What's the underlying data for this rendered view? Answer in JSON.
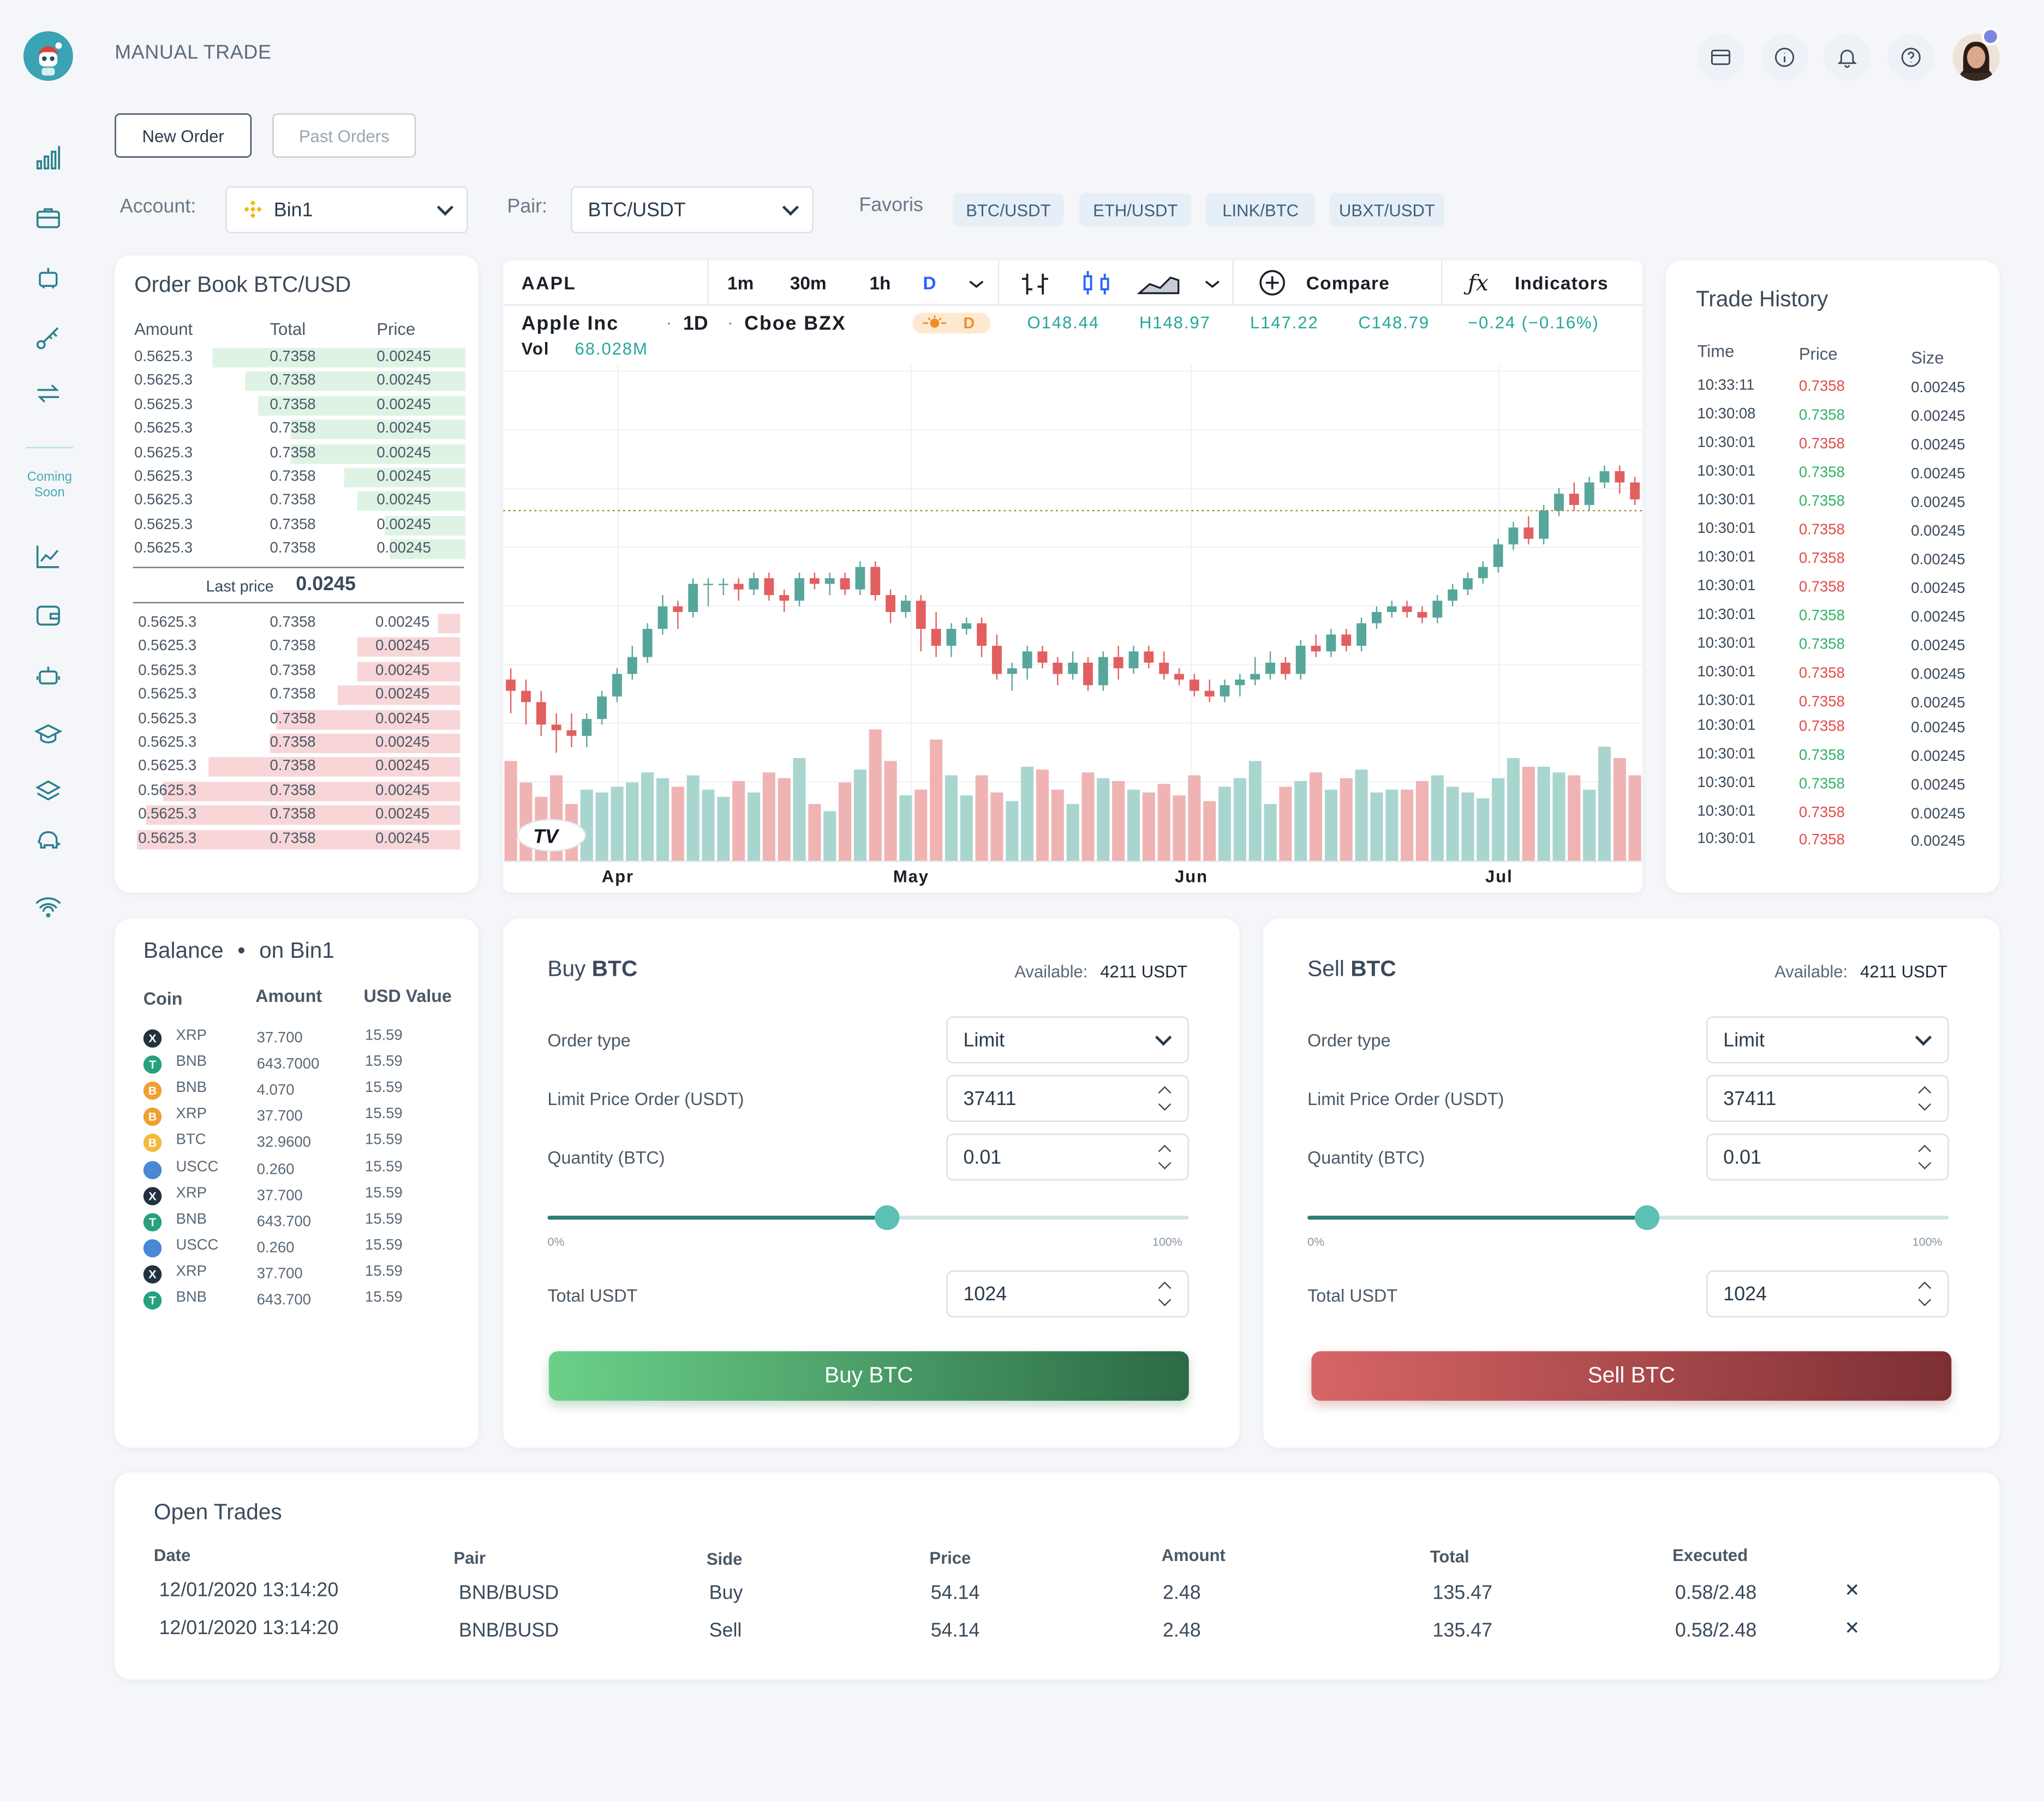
{
  "app": {
    "title": "MANUAL TRADE"
  },
  "sidebar": {
    "coming_soon": "Coming Soon"
  },
  "tabs": {
    "new_order": "New Order",
    "past_orders": "Past Orders"
  },
  "filters": {
    "account_label": "Account:",
    "account_value": "Bin1",
    "pair_label": "Pair:",
    "pair_value": "BTC/USDT",
    "favoris_label": "Favoris",
    "favorites": [
      "BTC/USDT",
      "ETH/USDT",
      "LINK/BTC",
      "UBXT/USDT"
    ]
  },
  "order_book": {
    "title": "Order Book BTC/USD",
    "headers": [
      "Amount",
      "Total",
      "Price"
    ],
    "asks": [
      {
        "amount": "0.5625.3",
        "total": "0.7358",
        "price": "0.00245",
        "depth": 1.0
      },
      {
        "amount": "0.5625.3",
        "total": "0.7358",
        "price": "0.00245",
        "depth": 0.87
      },
      {
        "amount": "0.5625.3",
        "total": "0.7358",
        "price": "0.00245",
        "depth": 0.82
      },
      {
        "amount": "0.5625.3",
        "total": "0.7358",
        "price": "0.00245",
        "depth": 0.69
      },
      {
        "amount": "0.5625.3",
        "total": "0.7358",
        "price": "0.00245",
        "depth": 0.69
      },
      {
        "amount": "0.5625.3",
        "total": "0.7358",
        "price": "0.00245",
        "depth": 0.48
      },
      {
        "amount": "0.5625.3",
        "total": "0.7358",
        "price": "0.00245",
        "depth": 0.43
      },
      {
        "amount": "0.5625.3",
        "total": "0.7358",
        "price": "0.00245",
        "depth": 0.32
      },
      {
        "amount": "0.5625.3",
        "total": "0.7358",
        "price": "0.00245",
        "depth": 0.3
      }
    ],
    "last_price_label": "Last price",
    "last_price": "0.0245",
    "bids": [
      {
        "amount": "0.5625.3",
        "total": "0.7358",
        "price": "0.00245",
        "depth": 0.07
      },
      {
        "amount": "0.5625.3",
        "total": "0.7358",
        "price": "0.00245",
        "depth": 0.32
      },
      {
        "amount": "0.5625.3",
        "total": "0.7358",
        "price": "0.00245",
        "depth": 0.32
      },
      {
        "amount": "0.5625.3",
        "total": "0.7358",
        "price": "0.00245",
        "depth": 0.38
      },
      {
        "amount": "0.5625.3",
        "total": "0.7358",
        "price": "0.00245",
        "depth": 0.57
      },
      {
        "amount": "0.5625.3",
        "total": "0.7358",
        "price": "0.00245",
        "depth": 0.59
      },
      {
        "amount": "0.5625.3",
        "total": "0.7358",
        "price": "0.00245",
        "depth": 0.78
      },
      {
        "amount": "0.5625.3",
        "total": "0.7358",
        "price": "0.00245",
        "depth": 0.92
      },
      {
        "amount": "0.5625.3",
        "total": "0.7358",
        "price": "0.00245",
        "depth": 0.97
      },
      {
        "amount": "0.5625.3",
        "total": "0.7358",
        "price": "0.00245",
        "depth": 1.0
      }
    ]
  },
  "chart": {
    "symbol": "AAPL",
    "intervals": [
      "1m",
      "30m",
      "1h",
      "D"
    ],
    "compare": "Compare",
    "indicators": "Indicators",
    "name": "Apple Inc",
    "sep": "·",
    "period": "1D",
    "exchange": "Cboe BZX",
    "badge": "D",
    "ohlc": {
      "o": "O148.44",
      "h": "H148.97",
      "l": "L147.22",
      "c": "C148.79",
      "chg": "−0.24 (−0.16%)"
    },
    "vol_label": "Vol",
    "vol_value": "68.028M",
    "logo": "TV",
    "x_labels": [
      "Apr",
      "May",
      "Jun",
      "Jul"
    ]
  },
  "chart_data": {
    "type": "candlestick",
    "x_labels": [
      "Apr",
      "May",
      "Jun",
      "Jul"
    ],
    "candles": [
      [
        130,
        128,
        124,
        132
      ],
      [
        128,
        126,
        122,
        130
      ],
      [
        126,
        122,
        120,
        128
      ],
      [
        122,
        121,
        117,
        124
      ],
      [
        121,
        120,
        118,
        124
      ],
      [
        120,
        123,
        118,
        124
      ],
      [
        123,
        127,
        122,
        128
      ],
      [
        127,
        131,
        126,
        132
      ],
      [
        131,
        134,
        130,
        136
      ],
      [
        134,
        139,
        133,
        140
      ],
      [
        139,
        143,
        138,
        145
      ],
      [
        143,
        142,
        139,
        144
      ],
      [
        142,
        147,
        141,
        148
      ],
      [
        147,
        147,
        143,
        148
      ],
      [
        147,
        147,
        145,
        148
      ],
      [
        147,
        146,
        144,
        148
      ],
      [
        146,
        148,
        145,
        149
      ],
      [
        148,
        145,
        144,
        149
      ],
      [
        145,
        144,
        142,
        146
      ],
      [
        144,
        148,
        143,
        149
      ],
      [
        148,
        147,
        146,
        149
      ],
      [
        147,
        148,
        145,
        149
      ],
      [
        148,
        146,
        145,
        149
      ],
      [
        146,
        150,
        145,
        151
      ],
      [
        150,
        145,
        144,
        151
      ],
      [
        145,
        142,
        140,
        146
      ],
      [
        142,
        144,
        141,
        145
      ],
      [
        144,
        139,
        135,
        145
      ],
      [
        139,
        136,
        134,
        142
      ],
      [
        136,
        139,
        134,
        140
      ],
      [
        139,
        140,
        138,
        141
      ],
      [
        140,
        136,
        134,
        141
      ],
      [
        136,
        131,
        130,
        138
      ],
      [
        131,
        132,
        128,
        133
      ],
      [
        132,
        135,
        130,
        136
      ],
      [
        135,
        133,
        132,
        136
      ],
      [
        133,
        131,
        129,
        134
      ],
      [
        131,
        133,
        130,
        135
      ],
      [
        133,
        129,
        128,
        134
      ],
      [
        129,
        134,
        128,
        135
      ],
      [
        134,
        132,
        130,
        136
      ],
      [
        132,
        135,
        131,
        136
      ],
      [
        135,
        133,
        132,
        136
      ],
      [
        133,
        131,
        130,
        135
      ],
      [
        131,
        130,
        129,
        132
      ],
      [
        130,
        128,
        127,
        131
      ],
      [
        128,
        127,
        126,
        130
      ],
      [
        127,
        129,
        126,
        130
      ],
      [
        129,
        130,
        127,
        131
      ],
      [
        130,
        131,
        129,
        134
      ],
      [
        131,
        133,
        130,
        135
      ],
      [
        133,
        131,
        130,
        134
      ],
      [
        131,
        136,
        130,
        137
      ],
      [
        136,
        135,
        134,
        138
      ],
      [
        135,
        138,
        134,
        139
      ],
      [
        138,
        136,
        135,
        139
      ],
      [
        136,
        140,
        135,
        141
      ],
      [
        140,
        142,
        139,
        143
      ],
      [
        142,
        143,
        141,
        144
      ],
      [
        143,
        142,
        141,
        144
      ],
      [
        142,
        141,
        140,
        143
      ],
      [
        141,
        144,
        140,
        145
      ],
      [
        144,
        146,
        143,
        147
      ],
      [
        146,
        148,
        145,
        149
      ],
      [
        148,
        150,
        147,
        151
      ],
      [
        150,
        154,
        149,
        155
      ],
      [
        154,
        157,
        153,
        158
      ],
      [
        157,
        155,
        154,
        159
      ],
      [
        155,
        160,
        154,
        161
      ],
      [
        160,
        163,
        159,
        164
      ],
      [
        163,
        161,
        160,
        165
      ],
      [
        161,
        165,
        160,
        166
      ],
      [
        165,
        167,
        164,
        168
      ],
      [
        167,
        165,
        163,
        168
      ],
      [
        165,
        162,
        161,
        166
      ]
    ],
    "volume": [
      70,
      55,
      45,
      60,
      40,
      50,
      48,
      52,
      55,
      62,
      58,
      52,
      60,
      50,
      45,
      56,
      48,
      62,
      58,
      72,
      40,
      35,
      55,
      64,
      92,
      70,
      46,
      50,
      85,
      60,
      46,
      60,
      48,
      42,
      66,
      64,
      50,
      40,
      62,
      58,
      56,
      50,
      48,
      54,
      46,
      60,
      42,
      52,
      58,
      70,
      40,
      52,
      56,
      62,
      50,
      58,
      64,
      48,
      50,
      50,
      56,
      60,
      52,
      48,
      44,
      58,
      72,
      66,
      66,
      62,
      60,
      50,
      80,
      72,
      60
    ],
    "last_price_line": 160
  },
  "trade_history": {
    "title": "Trade History",
    "headers": [
      "Time",
      "Price",
      "Size"
    ],
    "rows": [
      {
        "time": "10:33:11",
        "price": "0.7358",
        "size": "0.00245",
        "side": "sell"
      },
      {
        "time": "10:30:08",
        "price": "0.7358",
        "size": "0.00245",
        "side": "buy"
      },
      {
        "time": "10:30:01",
        "price": "0.7358",
        "size": "0.00245",
        "side": "sell"
      },
      {
        "time": "10:30:01",
        "price": "0.7358",
        "size": "0.00245",
        "side": "buy"
      },
      {
        "time": "10:30:01",
        "price": "0.7358",
        "size": "0.00245",
        "side": "buy"
      },
      {
        "time": "10:30:01",
        "price": "0.7358",
        "size": "0.00245",
        "side": "sell"
      },
      {
        "time": "10:30:01",
        "price": "0.7358",
        "size": "0.00245",
        "side": "sell"
      },
      {
        "time": "10:30:01",
        "price": "0.7358",
        "size": "0.00245",
        "side": "sell"
      },
      {
        "time": "10:30:01",
        "price": "0.7358",
        "size": "0.00245",
        "side": "buy"
      },
      {
        "time": "10:30:01",
        "price": "0.7358",
        "size": "0.00245",
        "side": "buy"
      },
      {
        "time": "10:30:01",
        "price": "0.7358",
        "size": "0.00245",
        "side": "sell"
      },
      {
        "time": "10:30:01",
        "price": "0.7358",
        "size": "0.00245",
        "side": "sell"
      },
      {
        "time": "10:30:01",
        "price": "0.7358",
        "size": "0.00245",
        "side": "sell"
      },
      {
        "time": "10:30:01",
        "price": "0.7358",
        "size": "0.00245",
        "side": "buy"
      },
      {
        "time": "10:30:01",
        "price": "0.7358",
        "size": "0.00245",
        "side": "buy"
      },
      {
        "time": "10:30:01",
        "price": "0.7358",
        "size": "0.00245",
        "side": "sell"
      },
      {
        "time": "10:30:01",
        "price": "0.7358",
        "size": "0.00245",
        "side": "sell"
      }
    ]
  },
  "balance": {
    "title": "Balance",
    "dot": "•",
    "on": "on Bin1",
    "headers": [
      "Coin",
      "Amount",
      "USD Value"
    ],
    "rows": [
      {
        "icon": "X",
        "coin": "XRP",
        "amount": "37.700",
        "usd": "15.59",
        "color": "#23313f"
      },
      {
        "icon": "T",
        "coin": "BNB",
        "amount": "643.7000",
        "usd": "15.59",
        "color": "#26a17b"
      },
      {
        "icon": "B",
        "coin": "BNB",
        "amount": "4.070",
        "usd": "15.59",
        "color": "#f0a033"
      },
      {
        "icon": "B",
        "coin": "XRP",
        "amount": "37.700",
        "usd": "15.59",
        "color": "#f0a033"
      },
      {
        "icon": "B",
        "coin": "BTC",
        "amount": "32.9600",
        "usd": "15.59",
        "color": "#f3b93a"
      },
      {
        "icon": "",
        "coin": "USCC",
        "amount": "0.260",
        "usd": "15.59",
        "color": "#4a88d6"
      },
      {
        "icon": "X",
        "coin": "XRP",
        "amount": "37.700",
        "usd": "15.59",
        "color": "#23313f"
      },
      {
        "icon": "T",
        "coin": "BNB",
        "amount": "643.700",
        "usd": "15.59",
        "color": "#26a17b"
      },
      {
        "icon": "",
        "coin": "USCC",
        "amount": "0.260",
        "usd": "15.59",
        "color": "#4a88d6"
      },
      {
        "icon": "X",
        "coin": "XRP",
        "amount": "37.700",
        "usd": "15.59",
        "color": "#23313f"
      },
      {
        "icon": "T",
        "coin": "BNB",
        "amount": "643.700",
        "usd": "15.59",
        "color": "#26a17b"
      }
    ]
  },
  "buy": {
    "title_pre": "Buy",
    "title_coin": "BTC",
    "available_label": "Available:",
    "available_value": "4211 USDT",
    "order_type_label": "Order type",
    "order_type_value": "Limit",
    "limit_label": "Limit Price Order (USDT)",
    "limit_value": "37411",
    "qty_label": "Quantity (BTC)",
    "qty_value": "0.01",
    "slider_min": "0%",
    "slider_max": "100%",
    "slider_pct": 0.53,
    "total_label": "Total USDT",
    "total_value": "1024",
    "button": "Buy BTC"
  },
  "sell": {
    "title_pre": "Sell",
    "title_coin": "BTC",
    "available_label": "Available:",
    "available_value": "4211 USDT",
    "order_type_label": "Order type",
    "order_type_value": "Limit",
    "limit_label": "Limit Price Order (USDT)",
    "limit_value": "37411",
    "qty_label": "Quantity (BTC)",
    "qty_value": "0.01",
    "slider_min": "0%",
    "slider_max": "100%",
    "slider_pct": 0.53,
    "total_label": "Total USDT",
    "total_value": "1024",
    "button": "Sell BTC"
  },
  "open_trades": {
    "title": "Open Trades",
    "headers": [
      "Date",
      "Pair",
      "Side",
      "Price",
      "Amount",
      "Total",
      "Executed"
    ],
    "rows": [
      {
        "date": "12/01/2020 13:14:20",
        "pair": "BNB/BUSD",
        "side": "Buy",
        "price": "54.14",
        "amount": "2.48",
        "total": "135.47",
        "executed": "0.58/2.48"
      },
      {
        "date": "12/01/2020 13:14:20",
        "pair": "BNB/BUSD",
        "side": "Sell",
        "price": "54.14",
        "amount": "2.48",
        "total": "135.47",
        "executed": "0.58/2.48"
      }
    ],
    "cancel_glyph": "✕"
  },
  "colors": {
    "accent": "#2b7f8c",
    "buy": "#2fb266",
    "sell": "#e24b4b",
    "ask_bar": "#dff3e4",
    "bid_bar": "#f8d6d8",
    "up": "#56a69b",
    "down": "#e25f60"
  }
}
